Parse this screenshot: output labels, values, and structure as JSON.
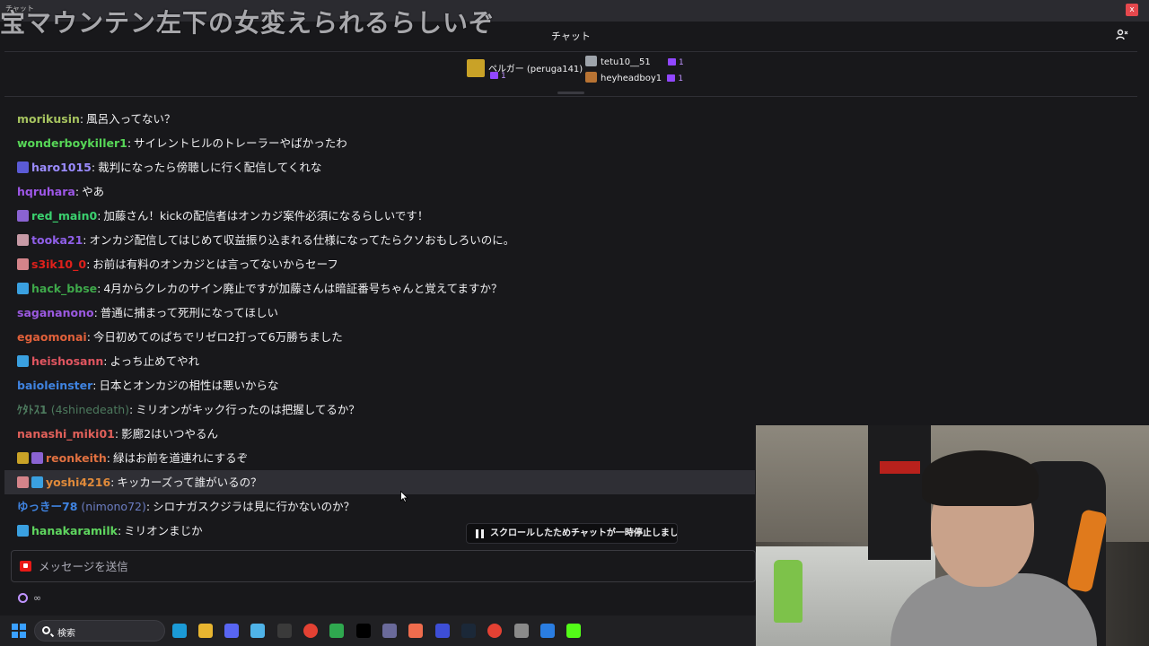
{
  "window": {
    "small_label": "チャット",
    "close_label": "x"
  },
  "overlay": {
    "text": "宝マウンテン左下の女変えられるらしいぞ"
  },
  "chat": {
    "title": "チャット",
    "gifters": [
      {
        "name": "ペルガー (peruga141)",
        "count": "1",
        "color": "#c9a227"
      },
      {
        "name": "tetu10__51",
        "count": "1",
        "color": "#9ea4ab"
      },
      {
        "name": "heyheadboy1",
        "count": "1",
        "color": "#b87333"
      }
    ],
    "messages": [
      {
        "user": "morikusin",
        "text": "風呂入ってない？",
        "color": "#a6c35f",
        "badges": []
      },
      {
        "user": "wonderboykiller1",
        "text": "サイレントヒルのトレーラーやばかったわ",
        "color": "#57d657",
        "badges": []
      },
      {
        "user": "haro1015",
        "text": "裁判になったら傍聴しに行く配信してくれな",
        "color": "#9b8cff",
        "badges": [
          "#5b5bd6"
        ]
      },
      {
        "user": "hqruhara",
        "text": "やあ",
        "color": "#9e57e8",
        "badges": []
      },
      {
        "user": "red_main0",
        "text": "加藤さん！kickの配信者はオンカジ案件必須になるらしいです！",
        "color": "#3bd16f",
        "badges": [
          "#8a63d2"
        ]
      },
      {
        "user": "tooka21",
        "text": "オンカジ配信してはじめて収益振り込まれる仕様になってたらクソおもしろいのに。",
        "color": "#8f5fe8",
        "badges": [
          "#c79aa6"
        ]
      },
      {
        "user": "s3ik10_0",
        "text": "お前は有料のオンカジとは言ってないからセーフ",
        "color": "#e0201b",
        "badges": [
          "#d4848a"
        ]
      },
      {
        "user": "hack_bbse",
        "text": "4月からクレカのサイン廃止ですが加藤さんは暗証番号ちゃんと覚えてますか？",
        "color": "#3ea84a",
        "badges": [
          "#3aa0e0"
        ]
      },
      {
        "user": "sagananono",
        "text": "普通に捕まって死刑になってほしい",
        "color": "#9b59e0",
        "badges": []
      },
      {
        "user": "egaomonai",
        "text": "今日初めてのぱちでリゼロ2打って6万勝ちました",
        "color": "#e0603a",
        "badges": []
      },
      {
        "user": "heishosann",
        "text": "よっち止めてやれ",
        "color": "#e05560",
        "badges": [
          "#3aa0e0"
        ]
      },
      {
        "user": "baioleinster",
        "text": "日本とオンカジの相性は悪いからな",
        "color": "#3f83e0",
        "badges": []
      },
      {
        "user": "ｹﾀﾄｽ1",
        "alt": "(4shinedeath)",
        "text": "ミリオンがキック行ったのは把握してるか？",
        "color": "#4d7a5e",
        "badges": []
      },
      {
        "user": "nanashi_miki01",
        "text": "影廊2はいつやるん",
        "color": "#e0605a",
        "badges": []
      },
      {
        "user": "reonkeith",
        "text": "緑はお前を道連れにするぞ",
        "color": "#e07040",
        "badges": [
          "#c9a227",
          "#8a63d2"
        ]
      },
      {
        "user": "yoshi4216",
        "text": "キッカーズって誰がいるの？",
        "color": "#e08a3a",
        "badges": [
          "#d4848a",
          "#3aa0e0"
        ],
        "highlight": true
      },
      {
        "user": "ゆっきー78",
        "alt": "(nimono72)",
        "text": "シロナガスクジラは見に行かないのか？",
        "color": "#3f83e0",
        "badges": []
      },
      {
        "user": "hanakaramilk",
        "text": "ミリオンまじか",
        "color": "#5fd65f",
        "badges": [
          "#3aa0e0"
        ]
      }
    ],
    "pause_banner": "スクロールしたためチャットが一時停止しました",
    "input": {
      "placeholder": "メッセージを送信"
    },
    "points": "∞"
  },
  "taskbar": {
    "search_label": "検索",
    "icons": [
      {
        "name": "windows-start-icon",
        "color": "#1e90ff"
      },
      {
        "name": "edge-icon",
        "color": "#1b9ad6"
      },
      {
        "name": "file-explorer-icon",
        "color": "#e8b530"
      },
      {
        "name": "discord-icon",
        "color": "#5865f2"
      },
      {
        "name": "notepad-icon",
        "color": "#4fb3e8"
      },
      {
        "name": "obs-icon",
        "color": "#3a3a3a"
      },
      {
        "name": "chrome-icon",
        "color": "#e34133"
      },
      {
        "name": "xbox-icon",
        "color": "#2fa84f"
      },
      {
        "name": "x-app-icon",
        "color": "#000000"
      },
      {
        "name": "wave-link-icon",
        "color": "#6a6a9a"
      },
      {
        "name": "triangle-app-icon",
        "color": "#ee6c4d"
      },
      {
        "name": "capture-icon",
        "color": "#3d4ed6"
      },
      {
        "name": "steam-icon",
        "color": "#1b2838"
      },
      {
        "name": "chrome-2-icon",
        "color": "#e34133"
      },
      {
        "name": "stream-deck-icon",
        "color": "#8a8a8a"
      },
      {
        "name": "bluetooth-icon",
        "color": "#2a7de1"
      },
      {
        "name": "kick-icon",
        "color": "#53fc18"
      }
    ]
  }
}
